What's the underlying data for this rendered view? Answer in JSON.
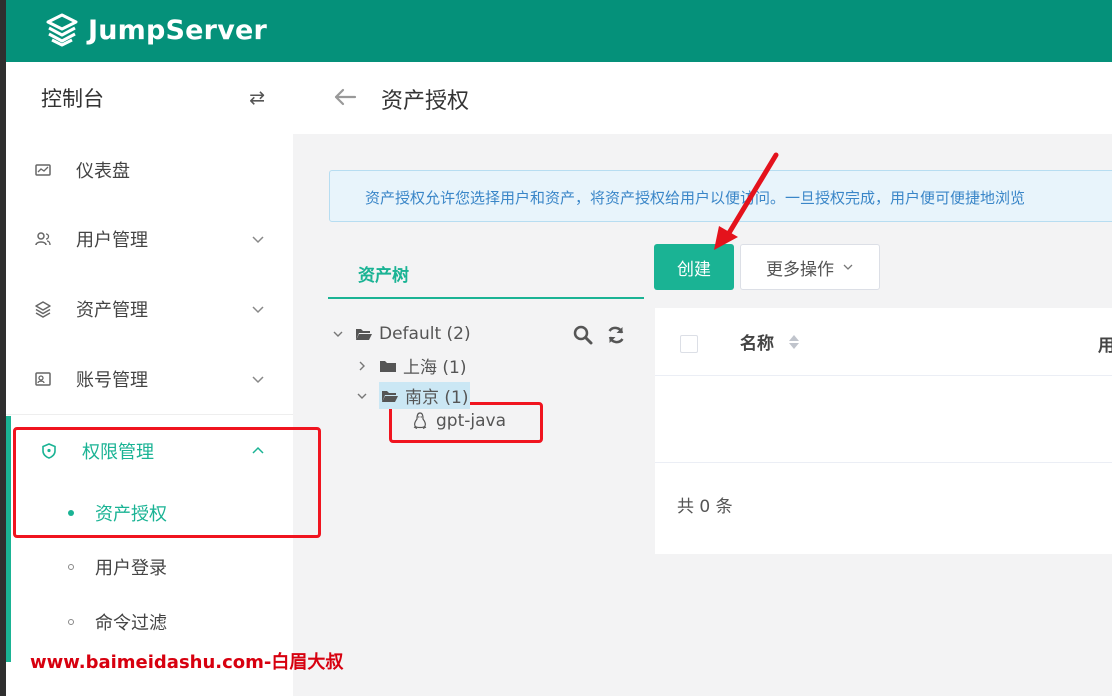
{
  "brand": {
    "name": "JumpServer",
    "header_color": "#05917a",
    "accent": "#1ab394"
  },
  "sidebar": {
    "title": "控制台",
    "toggle_icon": "⇄",
    "items": [
      {
        "label": "仪表盘",
        "icon": "dashboard-icon"
      },
      {
        "label": "用户管理",
        "icon": "users-icon"
      },
      {
        "label": "资产管理",
        "icon": "layers-icon"
      },
      {
        "label": "账号管理",
        "icon": "account-icon"
      },
      {
        "label": "权限管理",
        "icon": "shield-icon"
      }
    ],
    "subitems": [
      {
        "label": "资产授权",
        "active": true
      },
      {
        "label": "用户登录",
        "active": false
      },
      {
        "label": "命令过滤",
        "active": false
      }
    ]
  },
  "page": {
    "title": "资产授权",
    "info": "资产授权允许您选择用户和资产，将资产授权给用户以便访问。一旦授权完成，用户便可便捷地浏览"
  },
  "tree": {
    "tab_label": "资产树",
    "nodes": [
      {
        "label": "Default (2)"
      },
      {
        "label": "上海 (1)"
      },
      {
        "label": "南京 (1)"
      },
      {
        "label": "gpt-java",
        "icon": "linux-icon"
      }
    ]
  },
  "toolbar": {
    "create_label": "创建",
    "more_label": "更多操作"
  },
  "table": {
    "columns": [
      "名称",
      "用"
    ],
    "total_text": "共 0 条"
  },
  "watermark": "www.baimeidashu.com-白眉大叔"
}
